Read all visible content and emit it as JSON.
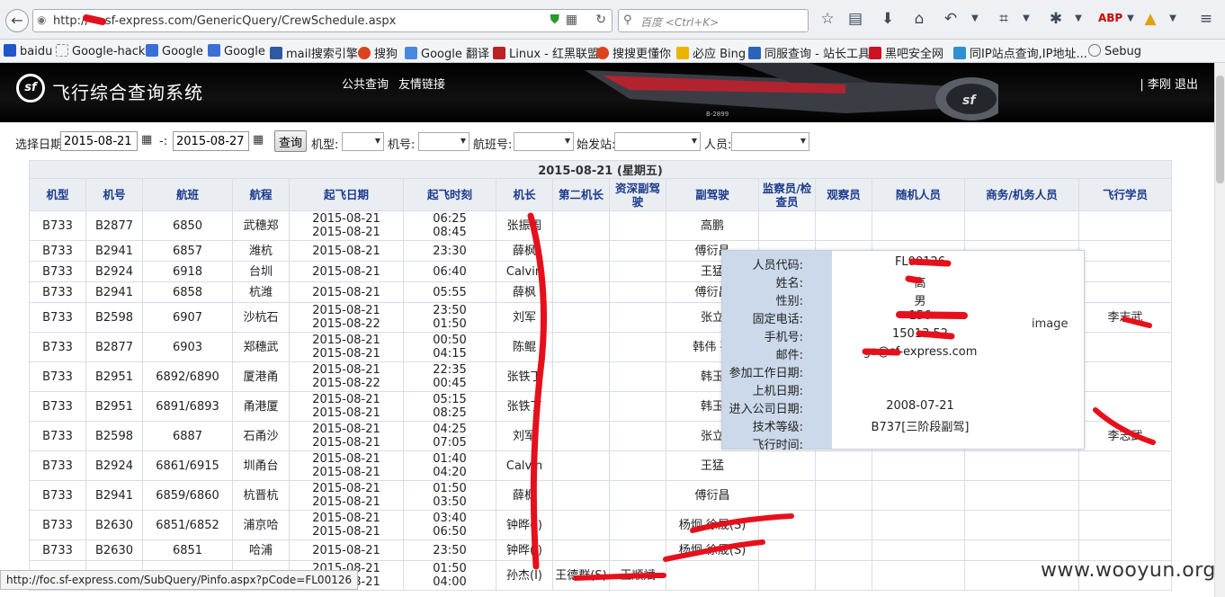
{
  "browser": {
    "url_prefix": "http://",
    "url_rest": "sf-express.com/GenericQuery/CrewSchedule.aspx",
    "search_placeholder": "百度 <Ctrl+K>",
    "bookmarks": [
      "baidu",
      "Google-hack",
      "Google",
      "Google",
      "mail搜索引擎",
      "搜狗",
      "Google 翻译",
      "Linux - 红黑联盟",
      "搜搜更懂你",
      "必应 Bing",
      "同服查询 - 站长工具",
      "黑吧安全网",
      "同IP站点查询,IP地址...",
      "Sebug"
    ],
    "status_url": "http://foc.sf-express.com/SubQuery/Pinfo.aspx?pCode=FL00126"
  },
  "site": {
    "title": "飞行综合查询系统",
    "logo_text": "sf",
    "links": [
      "公共查询",
      "友情链接"
    ],
    "user": "| 李刚 退出",
    "plane_reg": "B-2899"
  },
  "filters": {
    "date_label": "选择日期",
    "date_from": "2015-08-21",
    "sep": "-:",
    "date_to": "2015-08-27",
    "query_button": "查询",
    "type_label": "机型:",
    "reg_label": "机号:",
    "flight_label": "航班号:",
    "dep_label": "始发站:",
    "crew_label": "人员:"
  },
  "table": {
    "date_header": "2015-08-21 (星期五)",
    "columns": [
      "机型",
      "机号",
      "航班",
      "航程",
      "起飞日期",
      "起飞时刻",
      "机长",
      "第二机长",
      "资深副驾驶",
      "副驾驶",
      "监察员/检查员",
      "观察员",
      "随机人员",
      "商务/机务人员",
      "飞行学员"
    ],
    "rows": [
      {
        "type": "B733",
        "reg": "B2877",
        "flight": "6850",
        "route": "武穗郑",
        "date1": "2015-08-21",
        "date2": "2015-08-21",
        "time1": "06:25",
        "time2": "08:45",
        "captain": "张振周",
        "second": "",
        "senior": "",
        "fo": "高鹏",
        "trainee": ""
      },
      {
        "type": "B733",
        "reg": "B2941",
        "flight": "6857",
        "route": "潍杭",
        "date1": "2015-08-21",
        "date2": "",
        "time1": "23:30",
        "time2": "",
        "captain": "薛枫",
        "second": "",
        "senior": "",
        "fo": "傅衍昌",
        "trainee": ""
      },
      {
        "type": "B733",
        "reg": "B2924",
        "flight": "6918",
        "route": "台圳",
        "date1": "2015-08-21",
        "date2": "",
        "time1": "06:40",
        "time2": "",
        "captain": "Calvin",
        "second": "",
        "senior": "",
        "fo": "王猛",
        "trainee": ""
      },
      {
        "type": "B733",
        "reg": "B2941",
        "flight": "6858",
        "route": "杭潍",
        "date1": "2015-08-21",
        "date2": "",
        "time1": "05:55",
        "time2": "",
        "captain": "薛枫",
        "second": "",
        "senior": "",
        "fo": "傅衍昌",
        "trainee": ""
      },
      {
        "type": "B733",
        "reg": "B2598",
        "flight": "6907",
        "route": "沙杭石",
        "date1": "2015-08-21",
        "date2": "2015-08-22",
        "time1": "23:50",
        "time2": "01:50",
        "captain": "刘军",
        "second": "",
        "senior": "",
        "fo": "张立",
        "trainee": "李志武"
      },
      {
        "type": "B733",
        "reg": "B2877",
        "flight": "6903",
        "route": "郑穗武",
        "date1": "2015-08-21",
        "date2": "2015-08-21",
        "time1": "00:50",
        "time2": "04:15",
        "captain": "陈鲲",
        "second": "",
        "senior": "",
        "fo": "韩伟 孙",
        "trainee": ""
      },
      {
        "type": "B733",
        "reg": "B2951",
        "flight": "6892/6890",
        "route": "厦港甬",
        "date1": "2015-08-21",
        "date2": "2015-08-22",
        "time1": "22:35",
        "time2": "00:45",
        "captain": "张铁丁",
        "second": "",
        "senior": "",
        "fo": "韩玉",
        "trainee": ""
      },
      {
        "type": "B733",
        "reg": "B2951",
        "flight": "6891/6893",
        "route": "甬港厦",
        "date1": "2015-08-21",
        "date2": "2015-08-21",
        "time1": "05:15",
        "time2": "08:25",
        "captain": "张铁丁",
        "second": "",
        "senior": "",
        "fo": "韩玉",
        "trainee": ""
      },
      {
        "type": "B733",
        "reg": "B2598",
        "flight": "6887",
        "route": "石甬沙",
        "date1": "2015-08-21",
        "date2": "2015-08-21",
        "time1": "04:25",
        "time2": "07:05",
        "captain": "刘军",
        "second": "",
        "senior": "",
        "fo": "张立",
        "trainee": "李志武"
      },
      {
        "type": "B733",
        "reg": "B2924",
        "flight": "6861/6915",
        "route": "圳甬台",
        "date1": "2015-08-21",
        "date2": "2015-08-21",
        "time1": "01:40",
        "time2": "04:20",
        "captain": "Calvin",
        "second": "",
        "senior": "",
        "fo": "王猛",
        "trainee": ""
      },
      {
        "type": "B733",
        "reg": "B2941",
        "flight": "6859/6860",
        "route": "杭晋杭",
        "date1": "2015-08-21",
        "date2": "2015-08-21",
        "time1": "01:50",
        "time2": "03:50",
        "captain": "薛枫",
        "second": "",
        "senior": "",
        "fo": "傅衍昌",
        "trainee": ""
      },
      {
        "type": "B733",
        "reg": "B2630",
        "flight": "6851/6852",
        "route": "浦京哈",
        "date1": "2015-08-21",
        "date2": "2015-08-21",
        "time1": "03:40",
        "time2": "06:50",
        "captain": "钟晔(I)",
        "second": "",
        "senior": "",
        "fo": "杨炯 徐晟(S)",
        "trainee": ""
      },
      {
        "type": "B733",
        "reg": "B2630",
        "flight": "6851",
        "route": "哈浦",
        "date1": "2015-08-21",
        "date2": "",
        "time1": "23:50",
        "time2": "",
        "captain": "钟晔(I)",
        "second": "",
        "senior": "",
        "fo": "杨炯 徐晟(S)",
        "trainee": ""
      },
      {
        "type": "B733",
        "reg": "",
        "flight": "",
        "route": "",
        "date1": "2015-08-21",
        "date2": "2015-08-21",
        "time1": "01:50",
        "time2": "04:00",
        "captain": "孙杰(I)",
        "second": "王德群(S)",
        "senior": "王顺斌",
        "fo": "",
        "trainee": ""
      }
    ]
  },
  "popup": {
    "labels": [
      "人员代码:",
      "姓名:",
      "性别:",
      "固定电话:",
      "手机号:",
      "邮件:",
      "参加工作日期:",
      "上机日期:",
      "进入公司日期:",
      "技术等级:",
      "飞行时间:"
    ],
    "values": [
      "FL00126",
      "高",
      "男",
      "156",
      "15013   52",
      "ga@sf-express.com",
      "",
      "",
      "2008-07-21",
      "B737[三阶段副驾]",
      ""
    ],
    "image_label": "image"
  },
  "watermark": "www.wooyun.org"
}
